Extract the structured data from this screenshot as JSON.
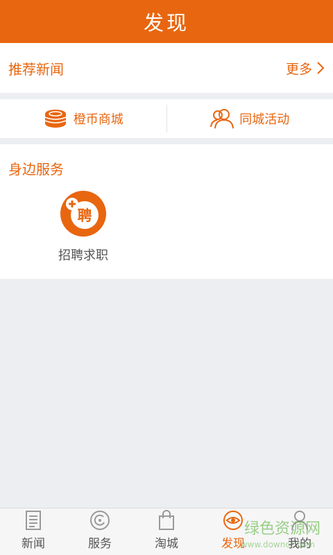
{
  "header": {
    "title": "发现"
  },
  "news": {
    "title": "推荐新闻",
    "more_label": "更多"
  },
  "quick_links": [
    {
      "label": "橙币商城",
      "icon": "coins-icon"
    },
    {
      "label": "同城活动",
      "icon": "people-icon"
    }
  ],
  "services": {
    "title": "身边服务",
    "items": [
      {
        "label": "招聘求职",
        "icon_text": "聘",
        "icon": "recruit-icon"
      }
    ]
  },
  "tabs": [
    {
      "label": "新闻",
      "icon": "newspaper-icon"
    },
    {
      "label": "服务",
      "icon": "service-icon"
    },
    {
      "label": "淘城",
      "icon": "shopping-bag-icon"
    },
    {
      "label": "发现",
      "icon": "eye-icon"
    },
    {
      "label": "我的",
      "icon": "user-icon"
    }
  ],
  "active_tab": "发现",
  "watermark": {
    "text": "绿色资源网",
    "sub": "www.downcc.com"
  },
  "colors": {
    "accent": "#e8660f",
    "background": "#eceef2",
    "text_muted": "#555555"
  }
}
